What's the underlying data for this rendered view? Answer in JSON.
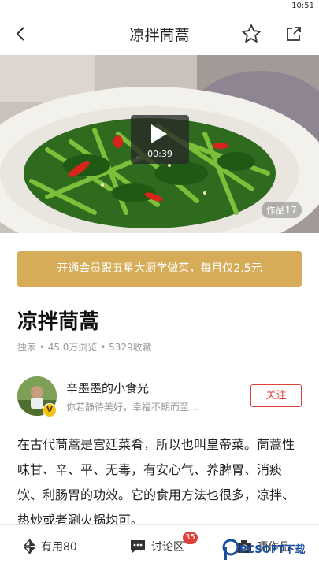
{
  "status_bar": {
    "time": "10:51"
  },
  "nav": {
    "title": "凉拌茼蒿",
    "back_icon": "back-arrow-icon",
    "favorite_icon": "star-icon",
    "share_icon": "share-icon"
  },
  "hero": {
    "video_duration": "00:39",
    "works_badge": "作品17"
  },
  "vip_banner": {
    "text": "开通会员跟五星大厨学做菜，每月仅2.5元"
  },
  "recipe": {
    "title": "凉拌茼蒿",
    "meta": "独家 • 45.0万浏览 • 5329收藏"
  },
  "author": {
    "name": "辛墨墨的小食光",
    "bio": "你若静待美好，幸福不期而至…",
    "badge": "V",
    "follow_label": "关注"
  },
  "description": "在古代茼蒿是宫廷菜肴，所以也叫皇帝菜。茼蒿性味甘、辛、平、无毒，有安心气、养脾胃、消痰饮、利肠胃的功效。它的食用方法也很多，凉拌、热炒或者涮火锅均可。",
  "bottom_bar": {
    "useful_label": "有用80",
    "comment_label": "讨论区",
    "comment_badge": "35",
    "works_label": "晒作品"
  },
  "watermark": {
    "text": "PCSOFT下载"
  },
  "colors": {
    "vip_gold": "#d6ac58",
    "follow_red": "#e0403a",
    "meta_gray": "#999999"
  }
}
